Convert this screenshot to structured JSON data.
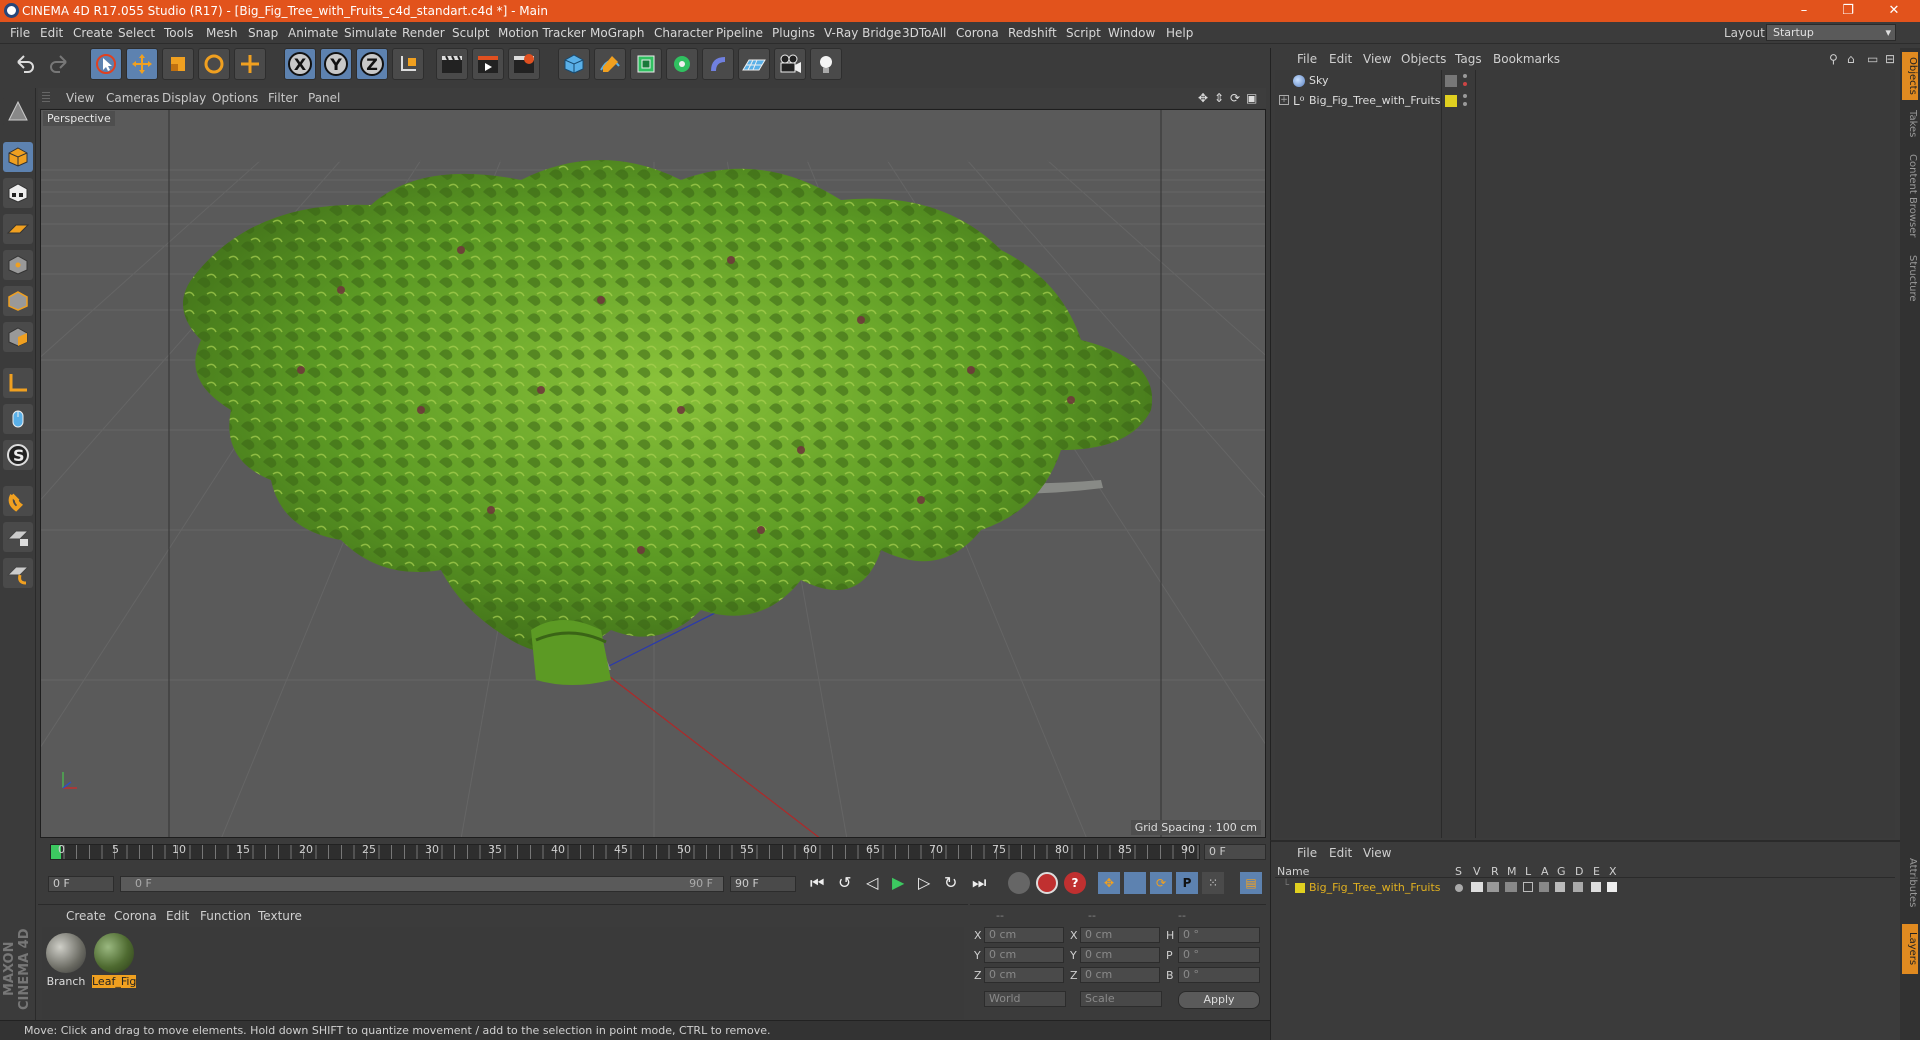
{
  "window": {
    "title": "CINEMA 4D R17.055 Studio (R17) - [Big_Fig_Tree_with_Fruits_c4d_standart.c4d *] - Main",
    "minimize": "–",
    "restore": "❐",
    "close": "✕"
  },
  "menu": [
    "File",
    "Edit",
    "Create",
    "Select",
    "Tools",
    "Mesh",
    "Snap",
    "Animate",
    "Simulate",
    "Render",
    "Sculpt",
    "Motion Tracker",
    "MoGraph",
    "Character",
    "Pipeline",
    "Plugins",
    "V-Ray Bridge",
    "3DToAll",
    "Corona",
    "Redshift",
    "Script",
    "Window",
    "Help"
  ],
  "layout": {
    "label": "Layout:",
    "value": "Startup"
  },
  "toolbar": {
    "x_label": "X",
    "y_label": "Y",
    "z_label": "Z"
  },
  "viewport": {
    "menu": [
      "View",
      "Cameras",
      "Display",
      "Options",
      "Filter",
      "Panel"
    ],
    "label": "Perspective",
    "grid_spacing": "Grid Spacing : 100 cm"
  },
  "timeline": {
    "ticks": [
      "0",
      "5",
      "10",
      "15",
      "20",
      "25",
      "30",
      "35",
      "40",
      "45",
      "50",
      "55",
      "60",
      "65",
      "70",
      "75",
      "80",
      "85",
      "90"
    ],
    "end_field": "0 F",
    "start_frame": "0 F",
    "slider_left": "0 F",
    "slider_right": "90 F",
    "end_frame": "90 F"
  },
  "materials": {
    "menu": [
      "Create",
      "Corona",
      "Edit",
      "Function",
      "Texture"
    ],
    "items": [
      {
        "name": "Branch",
        "selected": false
      },
      {
        "name": "Leaf_Fig",
        "selected": true
      }
    ]
  },
  "coords": {
    "header": [
      "--",
      "--",
      "--"
    ],
    "rows": [
      {
        "a": "X",
        "av": "0 cm",
        "b": "X",
        "bv": "0 cm",
        "c": "H",
        "cv": "0 °"
      },
      {
        "a": "Y",
        "av": "0 cm",
        "b": "Y",
        "bv": "0 cm",
        "c": "P",
        "cv": "0 °"
      },
      {
        "a": "Z",
        "av": "0 cm",
        "b": "Z",
        "bv": "0 cm",
        "c": "B",
        "cv": "0 °"
      }
    ],
    "mode1": "World",
    "mode2": "Scale",
    "apply": "Apply"
  },
  "status": "Move: Click and drag to move elements. Hold down SHIFT to quantize movement / add to the selection in point mode, CTRL to remove.",
  "objects": {
    "menu": [
      "File",
      "Edit",
      "View",
      "Objects",
      "Tags",
      "Bookmarks"
    ],
    "items": [
      {
        "name": "Sky"
      },
      {
        "name": "Big_Fig_Tree_with_Fruits"
      }
    ],
    "tag_color": "#e0d020"
  },
  "layers": {
    "menu": [
      "File",
      "Edit",
      "View"
    ],
    "columns": [
      "Name",
      "S",
      "V",
      "R",
      "M",
      "L",
      "A",
      "G",
      "D",
      "E",
      "X"
    ],
    "items": [
      {
        "name": "Big_Fig_Tree_with_Fruits"
      }
    ]
  },
  "right_tabs": [
    "Objects",
    "Takes",
    "Content Browser",
    "Structure",
    "Attributes",
    "Layers"
  ],
  "brand": "MAXON CINEMA 4D"
}
